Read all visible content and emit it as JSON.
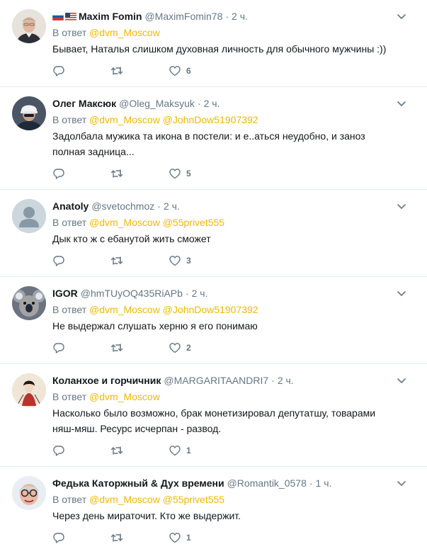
{
  "tweets": [
    {
      "name": "Maxim Fomin",
      "handle": "@MaximFomin78",
      "time": "2 ч.",
      "reply_prefix": "В ответ",
      "mentions": [
        "@dvm_Moscow"
      ],
      "text": "Бывает, Наталья слишком духовная личность для обычного мужчины :))",
      "likes": "6",
      "avatar": "photo-man-glasses",
      "flags": [
        "russia-flag",
        "usa-flag"
      ]
    },
    {
      "name": "Олег Максюк",
      "handle": "@Oleg_Maksyuk",
      "time": "2 ч.",
      "reply_prefix": "В ответ",
      "mentions": [
        "@dvm_Moscow",
        "@JohnDow51907392"
      ],
      "text": "Задолбала мужика та икона в постели: и е..аться неудобно, и заноз полная задница...",
      "likes": "5",
      "avatar": "photo-man-helmet"
    },
    {
      "name": "Anatoly",
      "handle": "@svetochmoz",
      "time": "2 ч.",
      "reply_prefix": "В ответ",
      "mentions": [
        "@dvm_Moscow",
        "@55privet555"
      ],
      "text": "Дык кто ж с ебанутой жить сможет",
      "likes": "3",
      "avatar": "default-avatar"
    },
    {
      "name": "IGOR",
      "handle": "@hmTUyOQ435RiAPb",
      "time": "2 ч.",
      "reply_prefix": "В ответ",
      "mentions": [
        "@dvm_Moscow",
        "@JohnDow51907392"
      ],
      "text": "Не выдержал слушать херню я его понимаю",
      "likes": "2",
      "avatar": "photo-koala"
    },
    {
      "name": "Коланхое и горчичник",
      "handle": "@MARGARITAANDRI7",
      "time": "2 ч.",
      "reply_prefix": "В ответ",
      "mentions": [
        "@dvm_Moscow"
      ],
      "text": "Насколько было возможно, брак монетизировал депутатшу, товарами няш-мяш. Ресурс исчерпан - развод.",
      "likes": "1",
      "avatar": "art-figure"
    },
    {
      "name": "Федька Каторжный & Дух времени",
      "handle": "@Romantik_0578",
      "time": "1 ч.",
      "reply_prefix": "В ответ",
      "mentions": [
        "@dvm_Moscow",
        "@55privet555"
      ],
      "text": "Через день мираточит. Кто же выдержит.",
      "likes": "1",
      "avatar": "photo-old-man-glasses"
    }
  ],
  "colors": {
    "mention": "#f0b800",
    "secondary": "#657786",
    "text": "#14171a",
    "border": "#e6ecf0"
  },
  "icons": [
    "reply-icon",
    "retweet-icon",
    "like-icon",
    "caret-down-icon"
  ]
}
